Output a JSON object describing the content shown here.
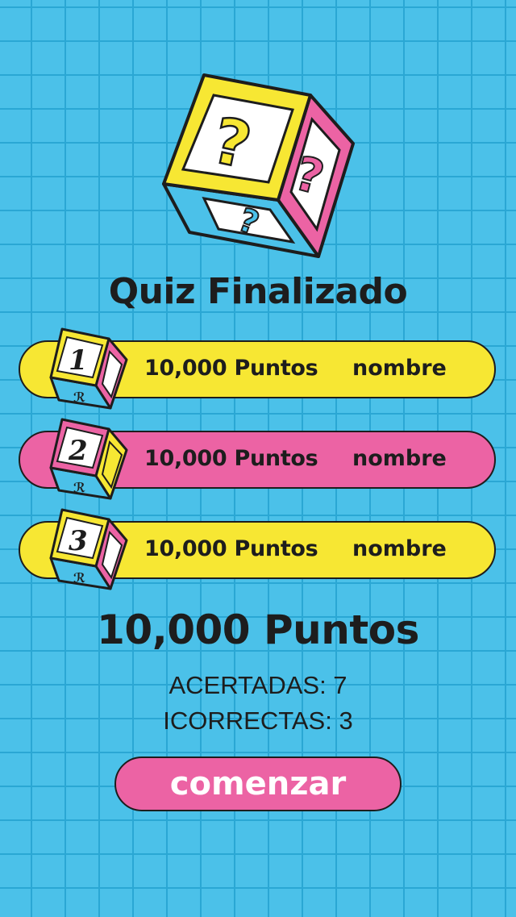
{
  "title": "Quiz Finalizado",
  "leaderboard": [
    {
      "rank": "1",
      "points": "10,000 Puntos",
      "name": "nombre",
      "color": "#f7e733",
      "cube_front": "#f7e733",
      "cube_side": "#ec63a4"
    },
    {
      "rank": "2",
      "points": "10,000 Puntos",
      "name": "nombre",
      "color": "#ec63a4",
      "cube_front": "#ec63a4",
      "cube_side": "#f7e733"
    },
    {
      "rank": "3",
      "points": "10,000 Puntos",
      "name": "nombre",
      "color": "#f7e733",
      "cube_front": "#f7e733",
      "cube_side": "#ec63a4"
    }
  ],
  "total_points": "10,000 Puntos",
  "stats": {
    "correct": "ACERTADAS: 7",
    "incorrect": "ICORRECTAS: 3"
  },
  "start_button": "comenzar",
  "icons": {
    "hero": "question-block-icon",
    "rank": "rank-cube-icon"
  },
  "colors": {
    "background": "#4bc1e9",
    "grid": "#2aa7d4",
    "yellow": "#f7e733",
    "pink": "#ec63a4",
    "ink": "#1d1d1d"
  }
}
